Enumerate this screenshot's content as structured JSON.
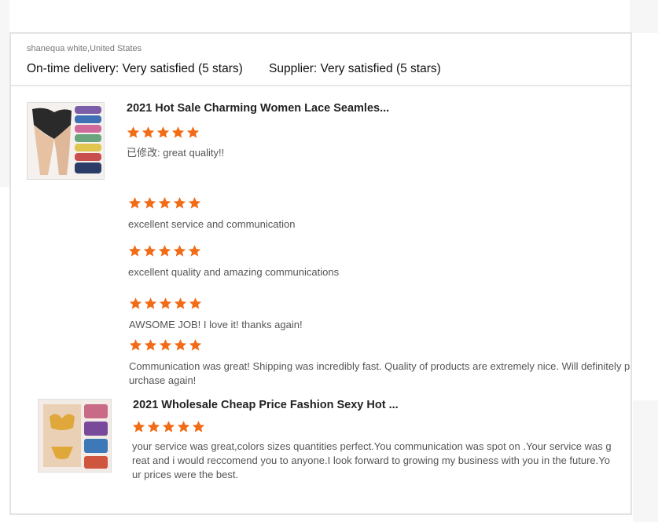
{
  "reviewer": "shanequa white,United States",
  "ratings": {
    "ontime": "On-time delivery: Very satisfied (5 stars)",
    "supplier": "Supplier: Very satisfied (5 stars)"
  },
  "products": [
    {
      "title": "2021 Hot Sale Charming Women Lace Seamles...",
      "rating": 5,
      "review": "已修改: great quality!!"
    },
    {
      "title": "2021 Wholesale Cheap Price Fashion Sexy Hot ...",
      "rating": 5,
      "review": "your service was great,colors sizes quantities perfect.You communication was spot on .Your service was great and i would reccomend you to anyone.I look forward to growing my business with you in the future.Your prices were the best."
    }
  ],
  "reviews": [
    {
      "rating": 5,
      "text": "excellent service and communication"
    },
    {
      "rating": 5,
      "text": "excellent quality and amazing communications"
    },
    {
      "rating": 5,
      "text": "AWSOME JOB! I love it! thanks again!"
    },
    {
      "rating": 5,
      "text": "Communication was great! Shipping was incredibly fast. Quality of products are extremely nice. Will definitely purchase again!"
    }
  ],
  "colors": {
    "star": "#f26b16",
    "border": "#e3e3e3"
  },
  "icons": {
    "star": "star-icon"
  }
}
